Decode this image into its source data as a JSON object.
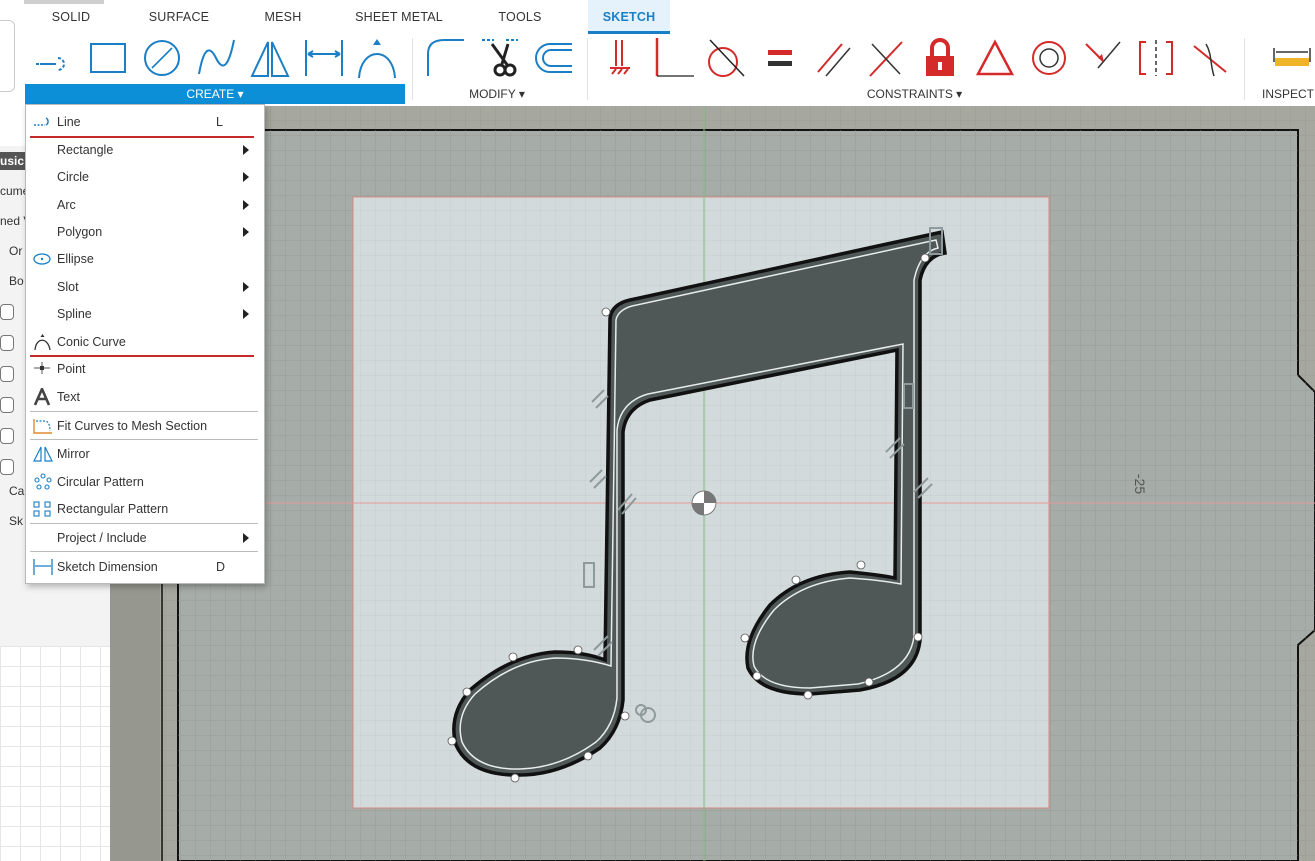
{
  "tabs": [
    {
      "label": "SOLID",
      "active": false
    },
    {
      "label": "SURFACE",
      "active": false
    },
    {
      "label": "MESH",
      "active": false
    },
    {
      "label": "SHEET METAL",
      "active": false
    },
    {
      "label": "TOOLS",
      "active": false
    },
    {
      "label": "SKETCH",
      "active": true
    }
  ],
  "groups": {
    "create": "CREATE ▾",
    "modify": "MODIFY ▾",
    "constraints": "CONSTRAINTS ▾",
    "inspect": "INSPECT"
  },
  "toolbar_icons": {
    "create": [
      "line-icon",
      "rectangle-icon",
      "circle-icon",
      "spline-icon",
      "mirror-icon",
      "dimension-icon",
      "conic-curve-icon"
    ],
    "modify": [
      "fillet-icon",
      "trim-icon",
      "offset-icon"
    ],
    "constraints": [
      "fix-icon",
      "coincident-icon",
      "tangent-icon",
      "equal-icon",
      "parallel-icon",
      "perpendicular-icon",
      "lock-icon",
      "triangle-icon",
      "concentric-icon",
      "midpoint-icon",
      "symmetry-icon",
      "curvature-icon"
    ],
    "inspect": [
      "measure-icon"
    ]
  },
  "menu": {
    "items": [
      {
        "label": "Line",
        "shortcut": "L",
        "submenu": false,
        "icon": "line-icon"
      },
      {
        "label": "Rectangle",
        "shortcut": "",
        "submenu": true,
        "icon": ""
      },
      {
        "label": "Circle",
        "shortcut": "",
        "submenu": true,
        "icon": ""
      },
      {
        "label": "Arc",
        "shortcut": "",
        "submenu": true,
        "icon": ""
      },
      {
        "label": "Polygon",
        "shortcut": "",
        "submenu": true,
        "icon": ""
      },
      {
        "label": "Ellipse",
        "shortcut": "",
        "submenu": false,
        "icon": "ellipse-icon"
      },
      {
        "label": "Slot",
        "shortcut": "",
        "submenu": true,
        "icon": ""
      },
      {
        "label": "Spline",
        "shortcut": "",
        "submenu": true,
        "icon": ""
      },
      {
        "label": "Conic Curve",
        "shortcut": "",
        "submenu": false,
        "icon": "conic-curve-icon"
      },
      {
        "label": "Point",
        "shortcut": "",
        "submenu": false,
        "icon": "point-icon"
      },
      {
        "label": "Text",
        "shortcut": "",
        "submenu": false,
        "icon": "text-icon"
      },
      {
        "label": "Fit Curves to Mesh Section",
        "shortcut": "",
        "submenu": false,
        "icon": "fit-curves-icon"
      },
      {
        "label": "Mirror",
        "shortcut": "",
        "submenu": false,
        "icon": "mirror-icon"
      },
      {
        "label": "Circular Pattern",
        "shortcut": "",
        "submenu": false,
        "icon": "circular-pattern-icon"
      },
      {
        "label": "Rectangular Pattern",
        "shortcut": "",
        "submenu": false,
        "icon": "rectangular-pattern-icon"
      },
      {
        "label": "Project / Include",
        "shortcut": "",
        "submenu": true,
        "icon": ""
      },
      {
        "label": "Sketch Dimension",
        "shortcut": "D",
        "submenu": false,
        "icon": "sketch-dimension-icon"
      }
    ]
  },
  "browser": {
    "items": [
      "usic",
      "cume",
      "ned V",
      "Or",
      "Bo",
      "Ca",
      "Sk"
    ]
  },
  "canvas": {
    "dimension_label": "-25"
  },
  "colors": {
    "accent": "#0d8fd8",
    "constraint_red": "#d42a2a",
    "sketch_profile": "#4f5856",
    "canvas_bg": "#a6a89f"
  }
}
